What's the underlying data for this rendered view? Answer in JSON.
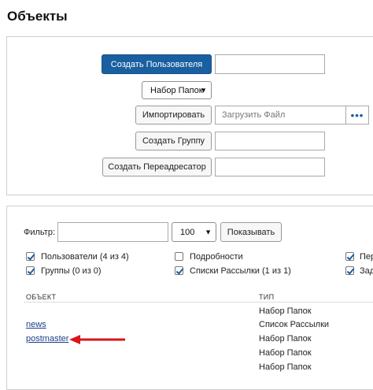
{
  "page": {
    "title": "Объекты"
  },
  "actions": {
    "create_user": "Создать Пользователя",
    "folder_set": "Набор Папок",
    "import": "Импортировать",
    "upload_placeholder": "Загрузить Файл",
    "create_group": "Создать Группу",
    "create_forwarder": "Создать Переадресатор"
  },
  "filter": {
    "label": "Фильтр:",
    "value": "",
    "page_size": "100",
    "show_button": "Показывать"
  },
  "options": [
    {
      "label": "Пользователи (4 из 4)",
      "checked": true
    },
    {
      "label": "Подробности",
      "checked": false
    },
    {
      "label": "Пер",
      "checked": true
    },
    {
      "label": "Группы (0 из 0)",
      "checked": true
    },
    {
      "label": "Списки Рассылки (1 из 1)",
      "checked": true
    },
    {
      "label": "Зад",
      "checked": true
    }
  ],
  "table": {
    "headers": {
      "object": "ОБЪЕКТ",
      "type": "ТИП"
    },
    "rows": [
      {
        "name": "",
        "type": "Набор Папок"
      },
      {
        "name": "news",
        "type": "Список Рассылки"
      },
      {
        "name": "postmaster",
        "type": "Набор Папок"
      },
      {
        "name": "",
        "type": "Набор Папок"
      },
      {
        "name": "",
        "type": "Набор Папок"
      }
    ]
  },
  "colors": {
    "primary": "#1a5fa0",
    "annotation_arrow": "#d9141b",
    "link": "#1b3f8a"
  }
}
